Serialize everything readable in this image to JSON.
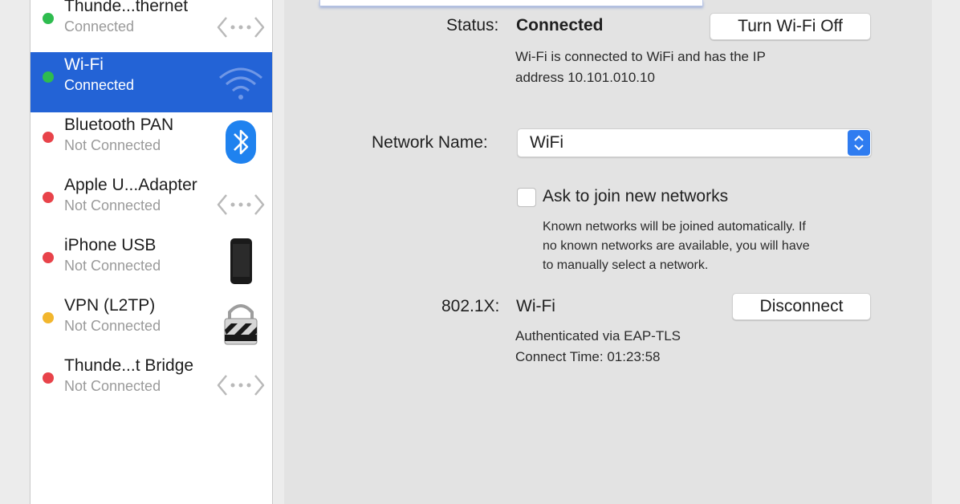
{
  "sidebar": {
    "services": [
      {
        "name": "Thunde...thernet",
        "status": "Connected",
        "dot_color": "#2ebc4f",
        "icon": "ethernet-arrows-icon",
        "selected": false
      },
      {
        "name": "Wi-Fi",
        "status": "Connected",
        "dot_color": "#2ebc4f",
        "icon": "wifi-icon",
        "selected": true
      },
      {
        "name": "Bluetooth PAN",
        "status": "Not Connected",
        "dot_color": "#e8434a",
        "icon": "bluetooth-icon",
        "selected": false
      },
      {
        "name": "Apple U...Adapter",
        "status": "Not Connected",
        "dot_color": "#e8434a",
        "icon": "ethernet-arrows-icon",
        "selected": false
      },
      {
        "name": "iPhone USB",
        "status": "Not Connected",
        "dot_color": "#e8434a",
        "icon": "iphone-icon",
        "selected": false
      },
      {
        "name": "VPN (L2TP)",
        "status": "Not Connected",
        "dot_color": "#f2b62d",
        "icon": "vpn-lock-icon",
        "selected": false
      },
      {
        "name": "Thunde...t Bridge",
        "status": "Not Connected",
        "dot_color": "#e8434a",
        "icon": "ethernet-arrows-icon",
        "selected": false
      }
    ]
  },
  "main": {
    "status_label": "Status:",
    "status_value": "Connected",
    "toggle_button": "Turn Wi-Fi Off",
    "status_detail_line1": "Wi-Fi is connected to WiFi and has the IP",
    "status_detail_line2": "address 10.101.010.10",
    "network_name_label": "Network Name:",
    "network_name_value": "WiFi",
    "ask_join_label": "Ask to join new networks",
    "ask_join_checked": false,
    "ask_join_help_line1": "Known networks will be joined automatically. If",
    "ask_join_help_line2": "no known networks are available, you will have",
    "ask_join_help_line3": "to manually select a network.",
    "dot1x_label": "802.1X:",
    "dot1x_value": "Wi-Fi",
    "disconnect_button": "Disconnect",
    "auth_line": "Authenticated via EAP-TLS",
    "connect_time_line": "Connect Time: 01:23:58"
  },
  "colors": {
    "selection_blue": "#2363d6",
    "connected_green": "#2ebc4f",
    "not_connected_red": "#e8434a",
    "vpn_yellow": "#f2b62d"
  }
}
